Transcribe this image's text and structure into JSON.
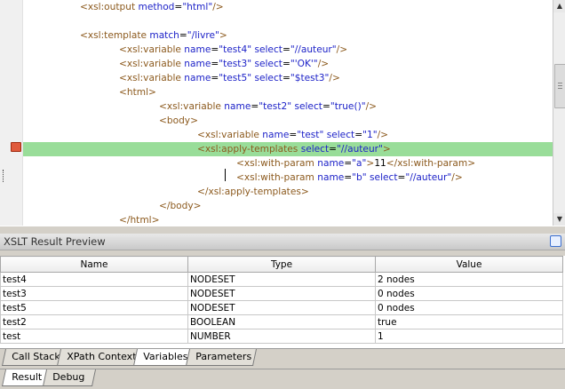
{
  "editor": {
    "lines": [
      {
        "indent": 1,
        "parts": [
          [
            "t",
            "<xsl:output "
          ],
          [
            "a",
            "method"
          ],
          [
            "x",
            "="
          ],
          [
            "v",
            "\"html\""
          ],
          [
            "t",
            "/>"
          ]
        ]
      },
      {
        "indent": 0,
        "parts": []
      },
      {
        "indent": 1,
        "parts": [
          [
            "t",
            "<xsl:template "
          ],
          [
            "a",
            "match"
          ],
          [
            "x",
            "="
          ],
          [
            "v",
            "\"/livre\""
          ],
          [
            "t",
            ">"
          ]
        ]
      },
      {
        "indent": 2,
        "parts": [
          [
            "t",
            "<xsl:variable "
          ],
          [
            "a",
            "name"
          ],
          [
            "x",
            "="
          ],
          [
            "v",
            "\"test4\""
          ],
          [
            "x",
            " "
          ],
          [
            "a",
            "select"
          ],
          [
            "x",
            "="
          ],
          [
            "v",
            "\"//auteur\""
          ],
          [
            "t",
            "/>"
          ]
        ]
      },
      {
        "indent": 2,
        "parts": [
          [
            "t",
            "<xsl:variable "
          ],
          [
            "a",
            "name"
          ],
          [
            "x",
            "="
          ],
          [
            "v",
            "\"test3\""
          ],
          [
            "x",
            " "
          ],
          [
            "a",
            "select"
          ],
          [
            "x",
            "="
          ],
          [
            "v",
            "\"'OK'\""
          ],
          [
            "t",
            "/>"
          ]
        ]
      },
      {
        "indent": 2,
        "parts": [
          [
            "t",
            "<xsl:variable "
          ],
          [
            "a",
            "name"
          ],
          [
            "x",
            "="
          ],
          [
            "v",
            "\"test5\""
          ],
          [
            "x",
            " "
          ],
          [
            "a",
            "select"
          ],
          [
            "x",
            "="
          ],
          [
            "v",
            "\"$test3\""
          ],
          [
            "t",
            "/>"
          ]
        ]
      },
      {
        "indent": 2,
        "parts": [
          [
            "t",
            "<html>"
          ]
        ]
      },
      {
        "indent": 3,
        "parts": [
          [
            "t",
            "<xsl:variable "
          ],
          [
            "a",
            "name"
          ],
          [
            "x",
            "="
          ],
          [
            "v",
            "\"test2\""
          ],
          [
            "x",
            " "
          ],
          [
            "a",
            "select"
          ],
          [
            "x",
            "="
          ],
          [
            "v",
            "\"true()\""
          ],
          [
            "t",
            "/>"
          ]
        ]
      },
      {
        "indent": 3,
        "parts": [
          [
            "t",
            "<body>"
          ]
        ]
      },
      {
        "indent": 4,
        "parts": [
          [
            "t",
            "<xsl:variable "
          ],
          [
            "a",
            "name"
          ],
          [
            "x",
            "="
          ],
          [
            "v",
            "\"test\""
          ],
          [
            "x",
            " "
          ],
          [
            "a",
            "select"
          ],
          [
            "x",
            "="
          ],
          [
            "v",
            "\"1\""
          ],
          [
            "t",
            "/>"
          ]
        ]
      },
      {
        "indent": 4,
        "highlight": true,
        "parts": [
          [
            "t",
            "<xsl:apply-templates "
          ],
          [
            "a",
            "select"
          ],
          [
            "x",
            "="
          ],
          [
            "v",
            "\"//auteur\""
          ],
          [
            "t",
            ">"
          ]
        ]
      },
      {
        "indent": 5,
        "parts": [
          [
            "t",
            "<xsl:with-param "
          ],
          [
            "a",
            "name"
          ],
          [
            "x",
            "="
          ],
          [
            "v",
            "\"a\""
          ],
          [
            "t",
            ">"
          ],
          [
            "x",
            "11"
          ],
          [
            "t",
            "</xsl:with-param>"
          ]
        ]
      },
      {
        "indent": 5,
        "parts": [
          [
            "t",
            "<xsl:with-param "
          ],
          [
            "a",
            "name"
          ],
          [
            "x",
            "="
          ],
          [
            "v",
            "\"b\""
          ],
          [
            "x",
            " "
          ],
          [
            "a",
            "select"
          ],
          [
            "x",
            "="
          ],
          [
            "v",
            "\"//auteur\""
          ],
          [
            "t",
            "/>"
          ]
        ]
      },
      {
        "indent": 4,
        "parts": [
          [
            "t",
            "</xsl:apply-templates>"
          ]
        ]
      },
      {
        "indent": 3,
        "parts": [
          [
            "t",
            "</body>"
          ]
        ]
      },
      {
        "indent": 2,
        "parts": [
          [
            "t",
            "</html>"
          ]
        ]
      }
    ],
    "colors": {
      "tag": "#8c5a1e",
      "attr": "#1e23c8",
      "value": "#1e23c8",
      "highlight": "#99dd99"
    }
  },
  "preview": {
    "title": "XSLT Result Preview",
    "columns": [
      "Name",
      "Type",
      "Value"
    ],
    "rows": [
      [
        "test4",
        "NODESET",
        "2 nodes"
      ],
      [
        "test3",
        "NODESET",
        "0 nodes"
      ],
      [
        "test5",
        "NODESET",
        "0 nodes"
      ],
      [
        "test2",
        "BOOLEAN",
        "true"
      ],
      [
        "test",
        "NUMBER",
        "1"
      ]
    ]
  },
  "debug_tabs": [
    "Call Stack",
    "XPath Context",
    "Variables",
    "Parameters"
  ],
  "debug_tabs_active": "Variables",
  "bottom_tabs": [
    "Result",
    "Debug"
  ],
  "bottom_tabs_active": "Result"
}
